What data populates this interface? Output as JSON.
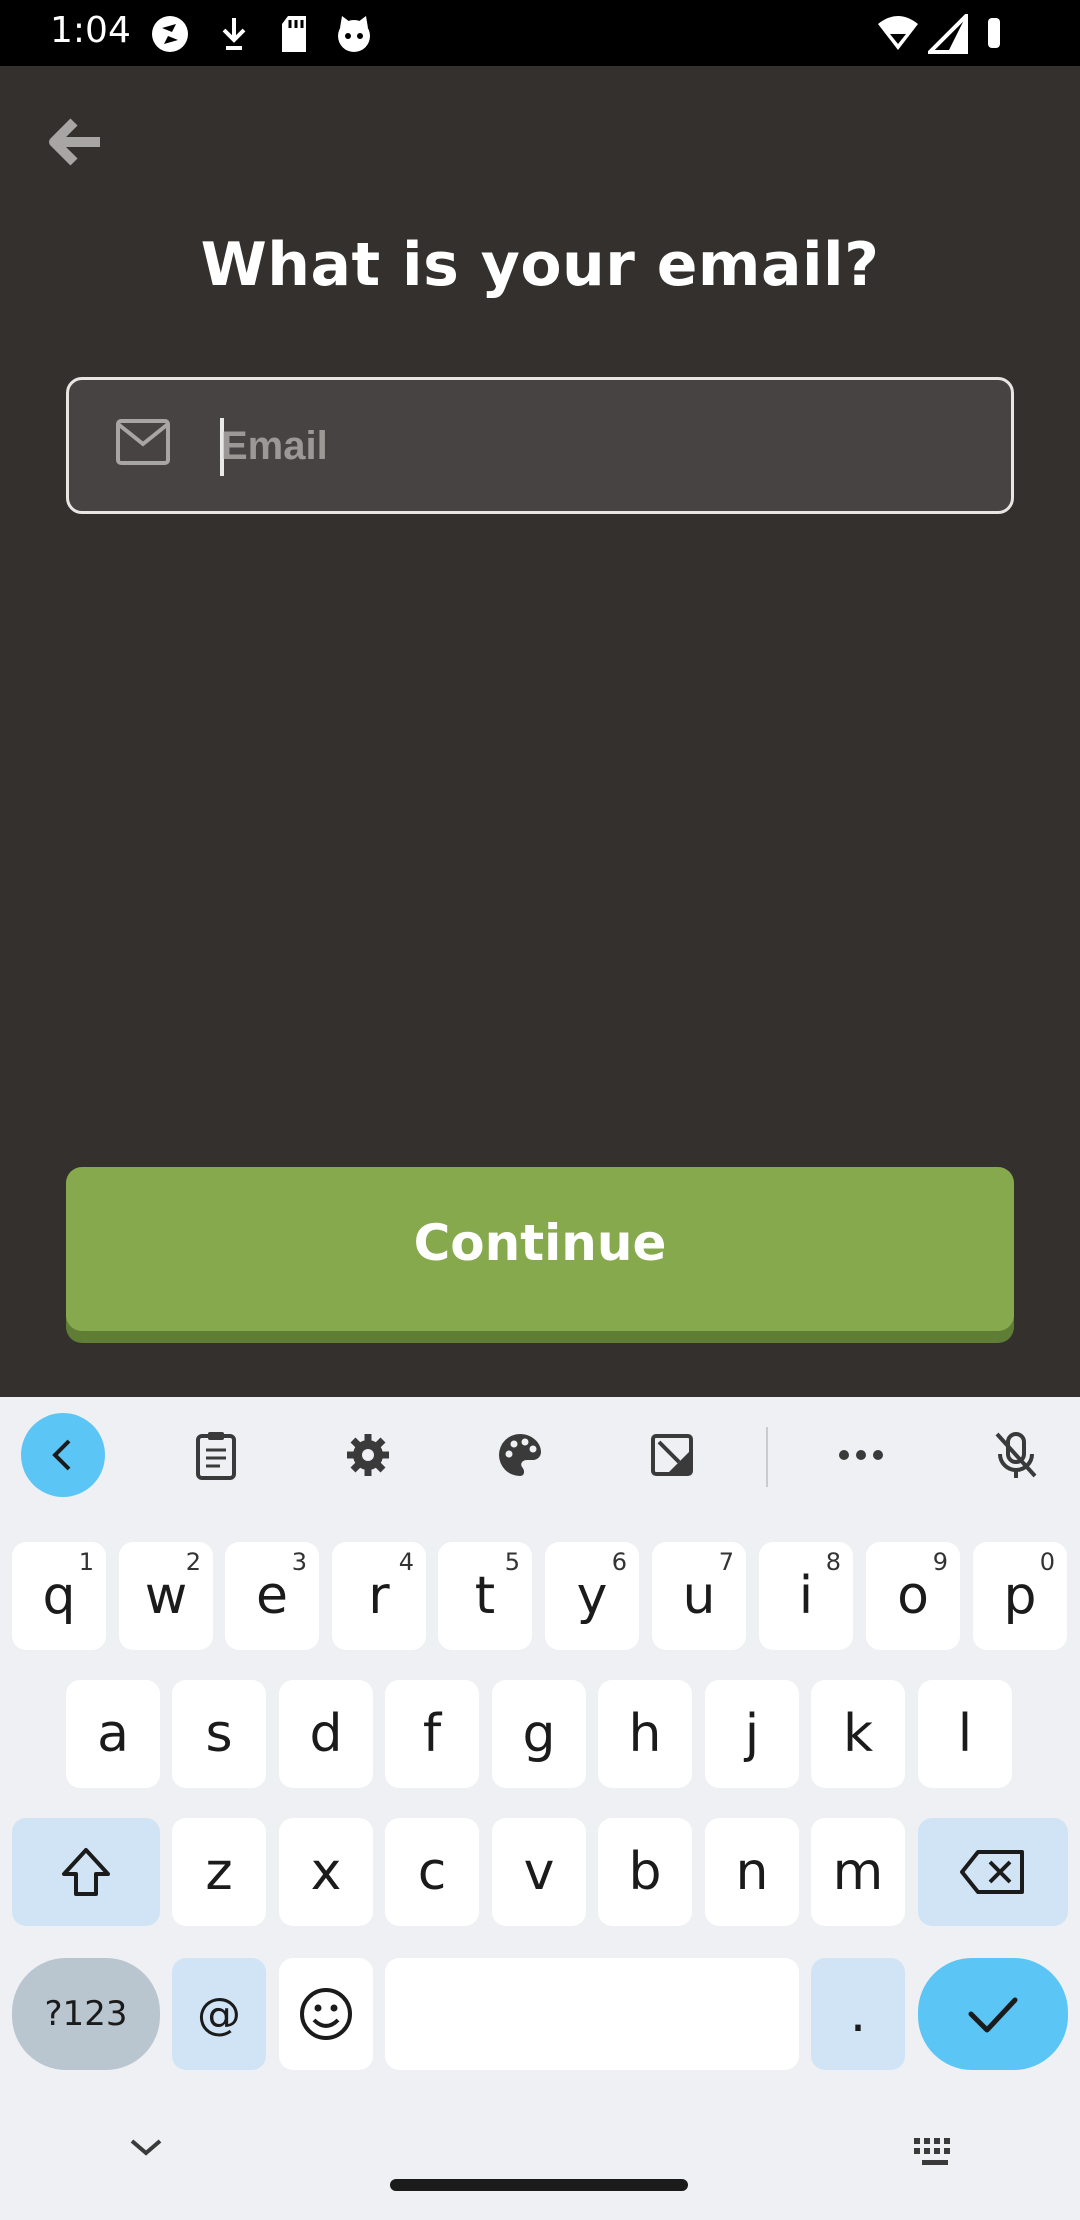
{
  "status_bar": {
    "time": "1:04",
    "left_icons": [
      "sync-icon",
      "download-icon",
      "sd-card-icon",
      "cat-icon"
    ],
    "right_icons": [
      "wifi-icon",
      "signal-icon",
      "battery-icon"
    ]
  },
  "screen": {
    "title": "What is your email?",
    "email_field": {
      "placeholder": "Email",
      "value": ""
    },
    "continue_label": "Continue",
    "colors": {
      "background": "#33302e",
      "button": "#87a94d",
      "field": "#464342"
    }
  },
  "keyboard": {
    "toolbar": [
      "chevron-left-icon",
      "clipboard-icon",
      "settings-icon",
      "palette-icon",
      "edit-image-icon",
      "more-icon",
      "mic-off-icon"
    ],
    "row1": [
      {
        "k": "q",
        "h": "1"
      },
      {
        "k": "w",
        "h": "2"
      },
      {
        "k": "e",
        "h": "3"
      },
      {
        "k": "r",
        "h": "4"
      },
      {
        "k": "t",
        "h": "5"
      },
      {
        "k": "y",
        "h": "6"
      },
      {
        "k": "u",
        "h": "7"
      },
      {
        "k": "i",
        "h": "8"
      },
      {
        "k": "o",
        "h": "9"
      },
      {
        "k": "p",
        "h": "0"
      }
    ],
    "row2": [
      "a",
      "s",
      "d",
      "f",
      "g",
      "h",
      "j",
      "k",
      "l"
    ],
    "row3": [
      "z",
      "x",
      "c",
      "v",
      "b",
      "n",
      "m"
    ],
    "row4": {
      "symbols": "?123",
      "at": "@",
      "period": "."
    }
  }
}
